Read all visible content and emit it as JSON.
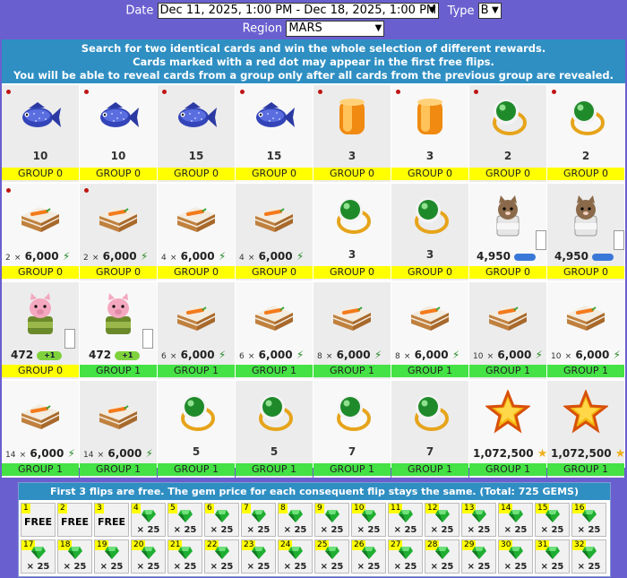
{
  "header": {
    "date_label": "Date",
    "date_value": "Dec 11, 2025, 1:00 PM - Dec 18, 2025, 1:00 PM",
    "type_label": "Type",
    "type_value": "B",
    "region_label": "Region",
    "region_value": "MARS"
  },
  "banner": {
    "line1": "Search for two identical cards and win the whole selection of different rewards.",
    "line2": "Cards marked with a red dot may appear in the first free flips.",
    "line3": "You will be able to reveal cards from a group only after all cards from the previous group are revealed."
  },
  "cards": [
    {
      "icon": "fish-icon",
      "dot": true,
      "value": "10",
      "group": "GROUP 0",
      "g": 0
    },
    {
      "icon": "fish-icon",
      "dot": true,
      "value": "10",
      "group": "GROUP 0",
      "g": 0
    },
    {
      "icon": "fish-icon",
      "dot": true,
      "value": "15",
      "group": "GROUP 0",
      "g": 0
    },
    {
      "icon": "fish-icon",
      "dot": true,
      "value": "15",
      "group": "GROUP 0",
      "g": 0
    },
    {
      "icon": "amber-jar-icon",
      "dot": true,
      "value": "3",
      "group": "GROUP 0",
      "g": 0
    },
    {
      "icon": "amber-jar-icon",
      "dot": true,
      "value": "3",
      "group": "GROUP 0",
      "g": 0
    },
    {
      "icon": "emerald-ring-icon",
      "dot": true,
      "value": "2",
      "group": "GROUP 0",
      "g": 0
    },
    {
      "icon": "emerald-ring-icon",
      "dot": true,
      "value": "2",
      "group": "GROUP 0",
      "g": 0
    },
    {
      "icon": "carrot-cake-icon",
      "dot": true,
      "mult": "2",
      "times": "×",
      "value": "6,000",
      "suffix": "bolt",
      "group": "GROUP 0",
      "g": 0
    },
    {
      "icon": "carrot-cake-icon",
      "dot": true,
      "mult": "2",
      "times": "×",
      "value": "6,000",
      "suffix": "bolt",
      "group": "GROUP 0",
      "g": 0
    },
    {
      "icon": "carrot-cake-icon",
      "dot": false,
      "mult": "4",
      "times": "×",
      "value": "6,000",
      "suffix": "bolt",
      "group": "GROUP 0",
      "g": 0
    },
    {
      "icon": "carrot-cake-icon",
      "dot": false,
      "mult": "4",
      "times": "×",
      "value": "6,000",
      "suffix": "bolt",
      "group": "GROUP 0",
      "g": 0
    },
    {
      "icon": "emerald-ring-icon",
      "dot": false,
      "value": "3",
      "group": "GROUP 0",
      "g": 0
    },
    {
      "icon": "emerald-ring-icon",
      "dot": false,
      "value": "3",
      "group": "GROUP 0",
      "g": 0
    },
    {
      "icon": "cat-jar-icon",
      "dot": false,
      "value": "4,950",
      "suffix": "pill",
      "check": true,
      "group": "GROUP 0",
      "g": 0
    },
    {
      "icon": "cat-jar-icon",
      "dot": false,
      "value": "4,950",
      "suffix": "pill",
      "check": true,
      "group": "GROUP 0",
      "g": 0
    },
    {
      "icon": "pig-jar-icon",
      "dot": false,
      "value": "472",
      "suffix": "pillg",
      "pill_text": "+1",
      "check": true,
      "group": "GROUP 0",
      "g": 0
    },
    {
      "icon": "pig-jar-icon",
      "dot": false,
      "value": "472",
      "suffix": "pillg",
      "pill_text": "+1",
      "check": true,
      "group": "GROUP 1",
      "g": 1
    },
    {
      "icon": "carrot-cake-icon",
      "dot": false,
      "mult": "6",
      "times": "×",
      "value": "6,000",
      "suffix": "bolt",
      "group": "GROUP 1",
      "g": 1
    },
    {
      "icon": "carrot-cake-icon",
      "dot": false,
      "mult": "6",
      "times": "×",
      "value": "6,000",
      "suffix": "bolt",
      "group": "GROUP 1",
      "g": 1
    },
    {
      "icon": "carrot-cake-icon",
      "dot": false,
      "mult": "8",
      "times": "×",
      "value": "6,000",
      "suffix": "bolt",
      "group": "GROUP 1",
      "g": 1
    },
    {
      "icon": "carrot-cake-icon",
      "dot": false,
      "mult": "8",
      "times": "×",
      "value": "6,000",
      "suffix": "bolt",
      "group": "GROUP 1",
      "g": 1
    },
    {
      "icon": "carrot-cake-icon",
      "dot": false,
      "mult": "10",
      "times": "×",
      "value": "6,000",
      "suffix": "bolt",
      "group": "GROUP 1",
      "g": 1
    },
    {
      "icon": "carrot-cake-icon",
      "dot": false,
      "mult": "10",
      "times": "×",
      "value": "6,000",
      "suffix": "bolt",
      "group": "GROUP 1",
      "g": 1
    },
    {
      "icon": "carrot-cake-icon",
      "dot": false,
      "mult": "14",
      "times": "×",
      "value": "6,000",
      "suffix": "bolt",
      "group": "GROUP 1",
      "g": 1
    },
    {
      "icon": "carrot-cake-icon",
      "dot": false,
      "mult": "14",
      "times": "×",
      "value": "6,000",
      "suffix": "bolt",
      "group": "GROUP 1",
      "g": 1
    },
    {
      "icon": "emerald-ring-icon",
      "dot": false,
      "value": "5",
      "group": "GROUP 1",
      "g": 1
    },
    {
      "icon": "emerald-ring-icon",
      "dot": false,
      "value": "5",
      "group": "GROUP 1",
      "g": 1
    },
    {
      "icon": "emerald-ring-icon",
      "dot": false,
      "value": "7",
      "group": "GROUP 1",
      "g": 1
    },
    {
      "icon": "emerald-ring-icon",
      "dot": false,
      "value": "7",
      "group": "GROUP 1",
      "g": 1
    },
    {
      "icon": "gold-star-icon",
      "dot": false,
      "value": "1,072,500",
      "suffix": "star",
      "group": "GROUP 1",
      "g": 1
    },
    {
      "icon": "gold-star-icon",
      "dot": false,
      "value": "1,072,500",
      "suffix": "star",
      "group": "GROUP 1",
      "g": 1
    }
  ],
  "flips": {
    "header": "First 3 flips are free. The gem price for each consequent flip stays the same. (Total: 725 GEMS)",
    "items": [
      {
        "n": "1",
        "free": "FREE"
      },
      {
        "n": "2",
        "free": "FREE"
      },
      {
        "n": "3",
        "free": "FREE"
      },
      {
        "n": "4",
        "cost": "× 25"
      },
      {
        "n": "5",
        "cost": "× 25"
      },
      {
        "n": "6",
        "cost": "× 25"
      },
      {
        "n": "7",
        "cost": "× 25"
      },
      {
        "n": "8",
        "cost": "× 25"
      },
      {
        "n": "9",
        "cost": "× 25"
      },
      {
        "n": "10",
        "cost": "× 25"
      },
      {
        "n": "11",
        "cost": "× 25"
      },
      {
        "n": "12",
        "cost": "× 25"
      },
      {
        "n": "13",
        "cost": "× 25"
      },
      {
        "n": "14",
        "cost": "× 25"
      },
      {
        "n": "15",
        "cost": "× 25"
      },
      {
        "n": "16",
        "cost": "× 25"
      },
      {
        "n": "17",
        "cost": "× 25"
      },
      {
        "n": "18",
        "cost": "× 25"
      },
      {
        "n": "19",
        "cost": "× 25"
      },
      {
        "n": "20",
        "cost": "× 25"
      },
      {
        "n": "21",
        "cost": "× 25"
      },
      {
        "n": "22",
        "cost": "× 25"
      },
      {
        "n": "23",
        "cost": "× 25"
      },
      {
        "n": "24",
        "cost": "× 25"
      },
      {
        "n": "25",
        "cost": "× 25"
      },
      {
        "n": "26",
        "cost": "× 25"
      },
      {
        "n": "27",
        "cost": "× 25"
      },
      {
        "n": "28",
        "cost": "× 25"
      },
      {
        "n": "29",
        "cost": "× 25"
      },
      {
        "n": "30",
        "cost": "× 25"
      },
      {
        "n": "31",
        "cost": "× 25"
      },
      {
        "n": "32",
        "cost": "× 25"
      }
    ]
  },
  "colors": {
    "background": "#6a5fcf",
    "banner": "#2f8fc3",
    "group0": "#ffff00",
    "group1": "#44e244"
  }
}
